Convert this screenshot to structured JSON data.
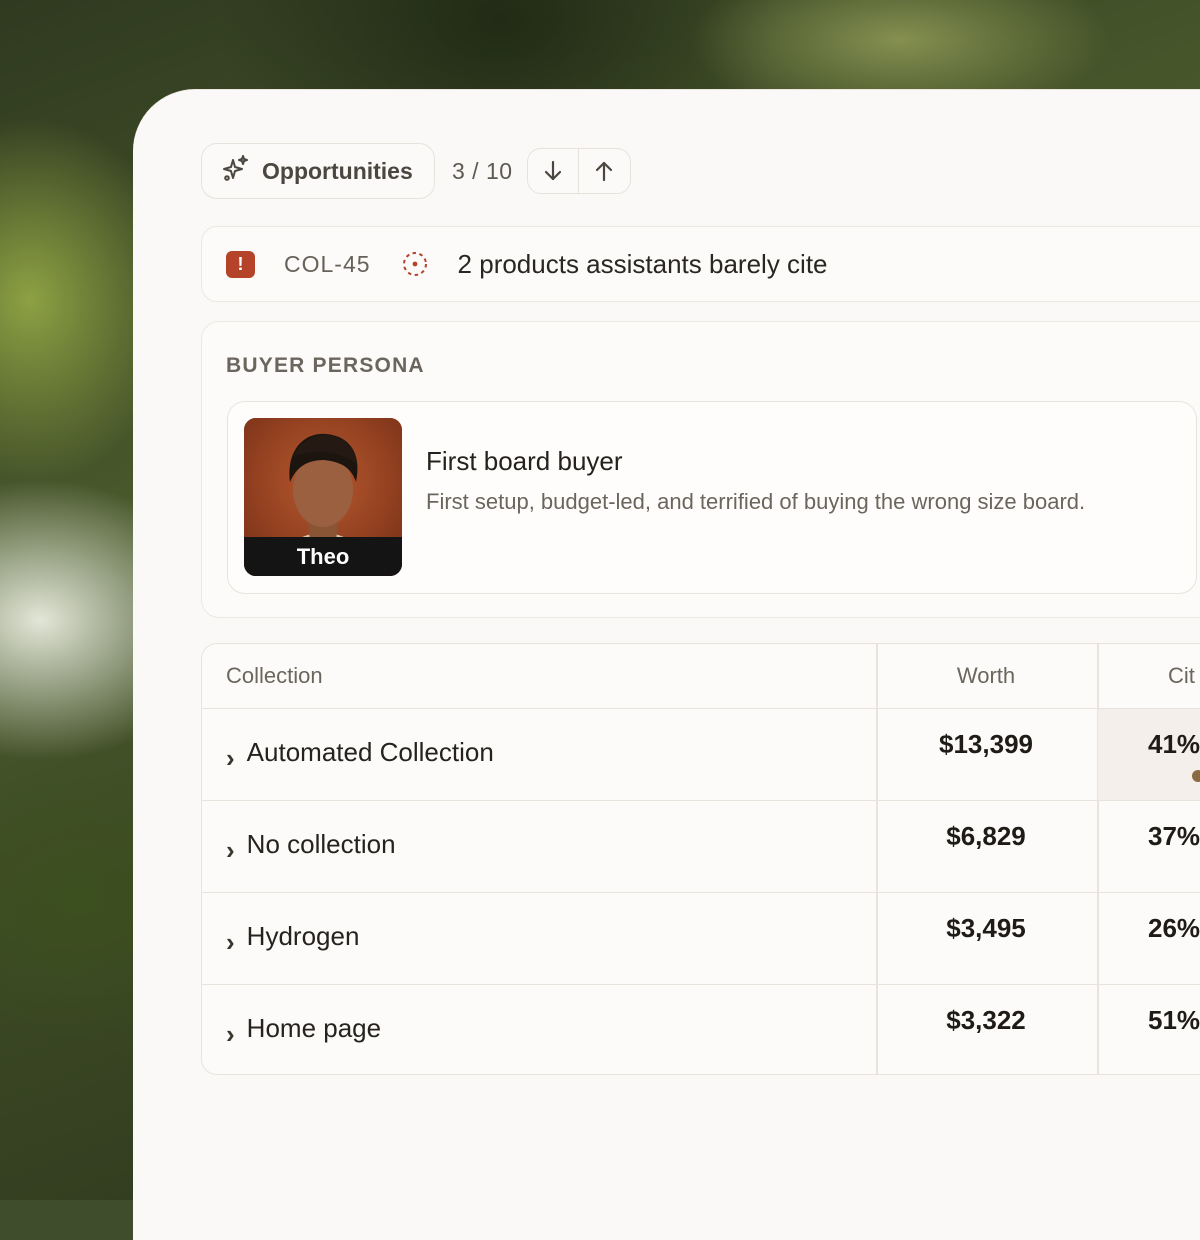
{
  "toolbar": {
    "opportunities_label": "Opportunities",
    "counter": "3 / 10",
    "icons": {
      "opportunities": "sparkles-icon",
      "down": "arrow-down-icon",
      "up": "arrow-up-icon"
    }
  },
  "issue": {
    "badge": "!",
    "id": "COL-45",
    "title": "2 products assistants barely cite",
    "badge_color": "#b5432a"
  },
  "persona": {
    "section_label": "BUYER PERSONA",
    "name": "Theo",
    "title": "First board buyer",
    "description": "First setup, budget-led, and terrified of buying the wrong size board."
  },
  "table": {
    "headers": {
      "collection": "Collection",
      "worth": "Worth",
      "cite": "Cit"
    },
    "rows": [
      {
        "name": "Automated Collection",
        "worth": "$13,399",
        "cite": "41%"
      },
      {
        "name": "No collection",
        "worth": "$6,829",
        "cite": "37%"
      },
      {
        "name": "Hydrogen",
        "worth": "$3,495",
        "cite": "26%"
      },
      {
        "name": "Home page",
        "worth": "$3,322",
        "cite": "51%"
      }
    ]
  }
}
